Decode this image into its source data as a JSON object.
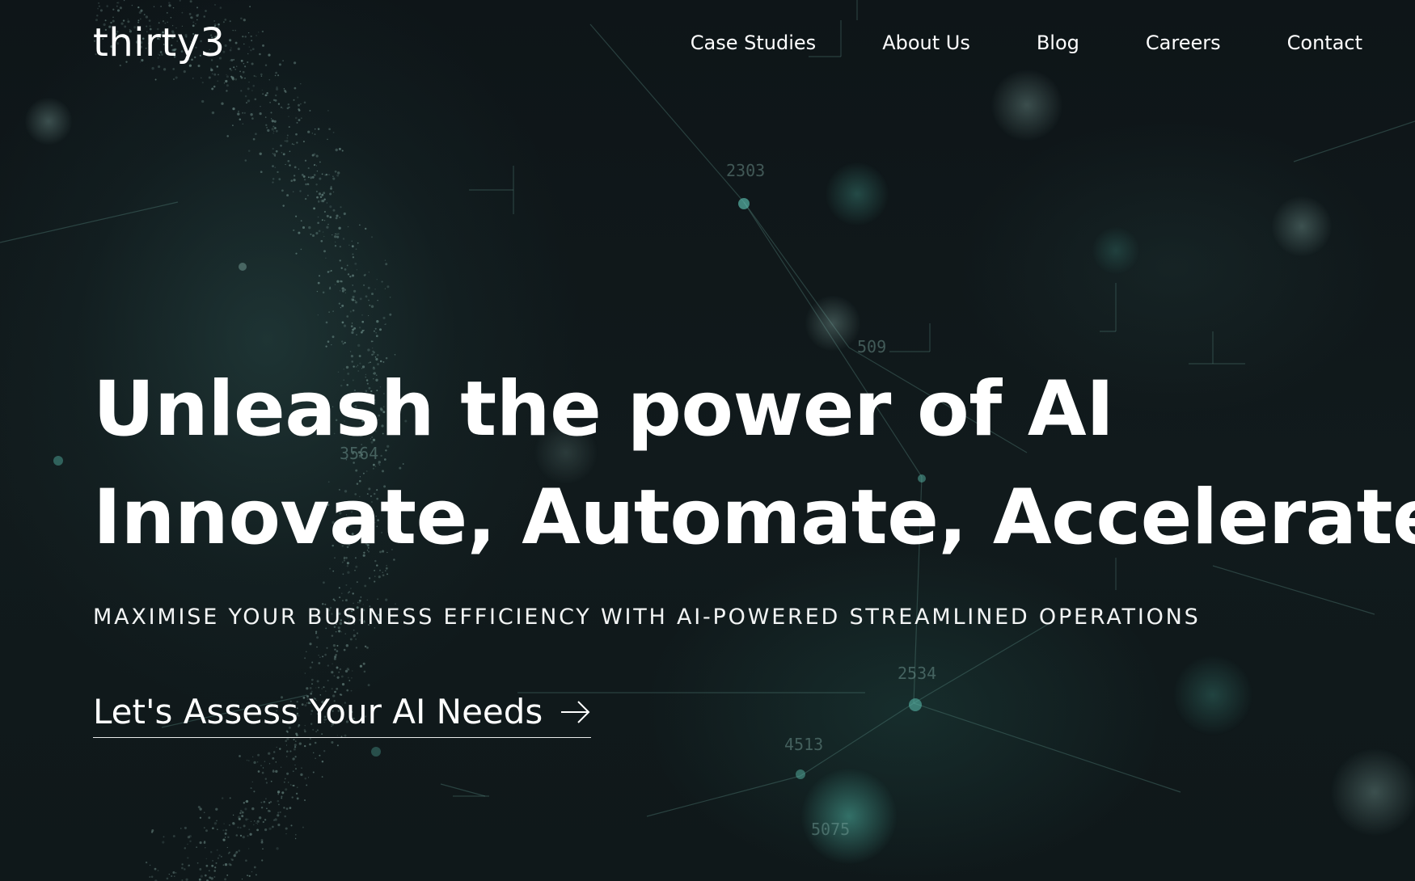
{
  "brand": {
    "logo_text": "thirty3"
  },
  "nav": {
    "items": [
      {
        "label": "Case Studies"
      },
      {
        "label": "About Us"
      },
      {
        "label": "Blog"
      },
      {
        "label": "Careers"
      },
      {
        "label": "Contact"
      }
    ]
  },
  "hero": {
    "headline_line1": "Unleash the power of AI",
    "headline_line2": "Innovate, Automate, Accelerate",
    "subtitle": "MAXIMISE YOUR BUSINESS EFFICIENCY WITH AI-POWERED STREAMLINED OPERATIONS",
    "cta_label": "Let's Assess Your AI Needs",
    "cta_icon": "arrow-right-icon"
  },
  "background": {
    "numbers": [
      "2303",
      "3564",
      "509",
      "2534",
      "4513",
      "5075"
    ]
  },
  "colors": {
    "background": "#0d1417",
    "text": "#ffffff",
    "accent_teal": "#3a8f84"
  }
}
